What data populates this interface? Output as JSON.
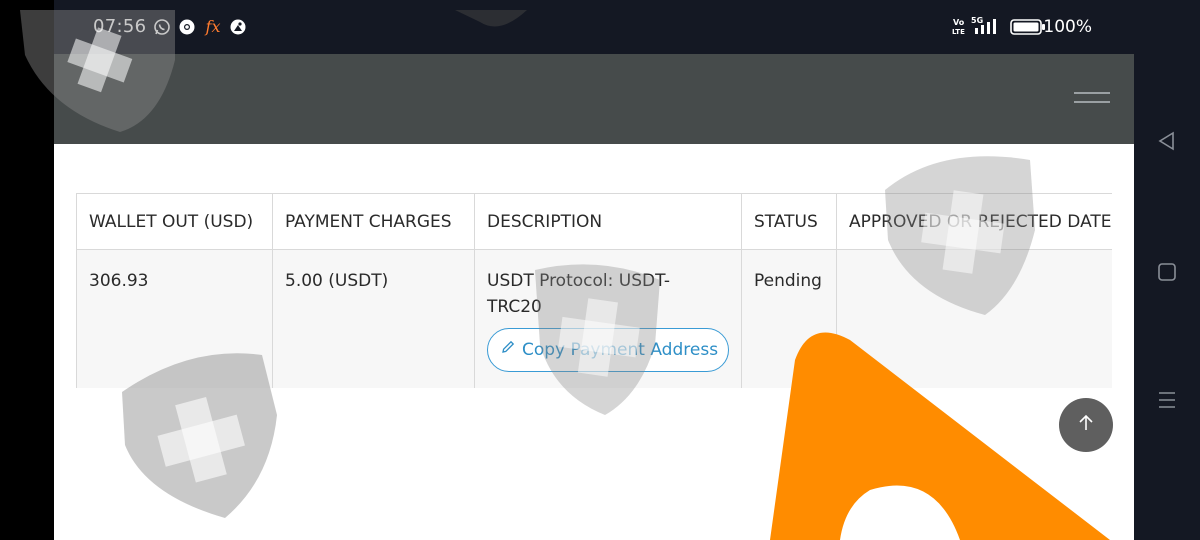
{
  "status_bar": {
    "time": "07:56",
    "icons": [
      "whatsapp-icon",
      "chrome-icon",
      "fx-icon",
      "app-icon"
    ],
    "signal_label": "5G",
    "volte_label": "Vo LTE",
    "battery_percent": "100%"
  },
  "header": {
    "menu_icon": "hamburger-icon"
  },
  "table": {
    "columns": [
      "WALLET OUT (USD)",
      "PAYMENT CHARGES",
      "DESCRIPTION",
      "STATUS",
      "APPROVED OR REJECTED DATE"
    ],
    "rows": [
      {
        "wallet_out": "306.93",
        "charges": "5.00 (USDT)",
        "description": "USDT Protocol: USDT-TRC20",
        "copy_button": "Copy Payment Address",
        "status": "Pending",
        "approved_date": ""
      }
    ]
  },
  "scroll_top_icon": "arrow-up-icon",
  "nav_bar": {
    "icons": [
      "back-icon",
      "home-icon",
      "recents-icon"
    ]
  },
  "colors": {
    "status_bar": "#141823",
    "header": "#464b4b",
    "accent": "#2e8fc7",
    "overlay_orange": "#ff8c00"
  }
}
